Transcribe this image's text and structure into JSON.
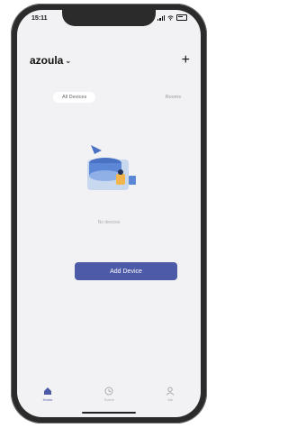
{
  "status": {
    "time": "15:11"
  },
  "header": {
    "home_name": "azoula",
    "add_label": "+"
  },
  "tabs": [
    {
      "label": "All Devices",
      "active": true
    },
    {
      "label": "Rooms",
      "active": false
    }
  ],
  "empty_state": {
    "message": "No devices"
  },
  "primary_button": {
    "label": "Add Device"
  },
  "tabbar": [
    {
      "label": "Home",
      "icon": "home-icon",
      "active": true
    },
    {
      "label": "Scene",
      "icon": "scene-icon",
      "active": false
    },
    {
      "label": "Me",
      "icon": "profile-icon",
      "active": false
    }
  ],
  "colors": {
    "accent": "#4c5aa8",
    "background": "#f2f2f4"
  }
}
